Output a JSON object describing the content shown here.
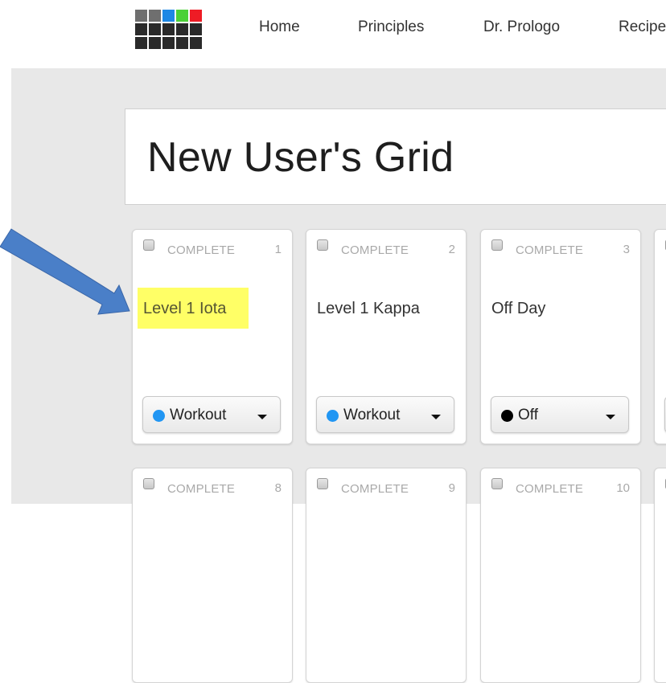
{
  "logo": {
    "name": "grid-logo",
    "colors": [
      [
        "#6f6f6f",
        "#6f6f6f",
        "#1e88e5",
        "#4cd137",
        "#ee1c25"
      ],
      [
        "#2a2a2a",
        "#2a2a2a",
        "#2a2a2a",
        "#2a2a2a",
        "#2a2a2a"
      ],
      [
        "#2a2a2a",
        "#2a2a2a",
        "#2a2a2a",
        "#2a2a2a",
        "#2a2a2a"
      ]
    ]
  },
  "nav": {
    "items": [
      {
        "label": "Home"
      },
      {
        "label": "Principles"
      },
      {
        "label": "Dr. Prologo"
      },
      {
        "label": "Recipe"
      }
    ]
  },
  "grid": {
    "title": "New User's Grid",
    "cards": [
      {
        "complete_label": "COMPLETE",
        "day": "1",
        "workout": "Level 1 Iota",
        "highlighted": true,
        "status": "Workout",
        "status_color": "#2196f3"
      },
      {
        "complete_label": "COMPLETE",
        "day": "2",
        "workout": "Level 1 Kappa",
        "highlighted": false,
        "status": "Workout",
        "status_color": "#2196f3"
      },
      {
        "complete_label": "COMPLETE",
        "day": "3",
        "workout": "Off Day",
        "highlighted": false,
        "status": "Off",
        "status_color": "#000000"
      },
      {
        "complete_label": "",
        "day": "",
        "workout": "",
        "highlighted": false,
        "status": "",
        "status_color": "#2196f3"
      },
      {
        "complete_label": "COMPLETE",
        "day": "8",
        "workout": "",
        "highlighted": false,
        "status": "",
        "status_color": ""
      },
      {
        "complete_label": "COMPLETE",
        "day": "9",
        "workout": "",
        "highlighted": false,
        "status": "",
        "status_color": ""
      },
      {
        "complete_label": "COMPLETE",
        "day": "10",
        "workout": "",
        "highlighted": false,
        "status": "",
        "status_color": ""
      },
      {
        "complete_label": "",
        "day": "",
        "workout": "",
        "highlighted": false,
        "status": "",
        "status_color": ""
      }
    ]
  },
  "annotation": {
    "arrow_color": "#4a7fc8",
    "highlight_color": "#ffff66"
  }
}
